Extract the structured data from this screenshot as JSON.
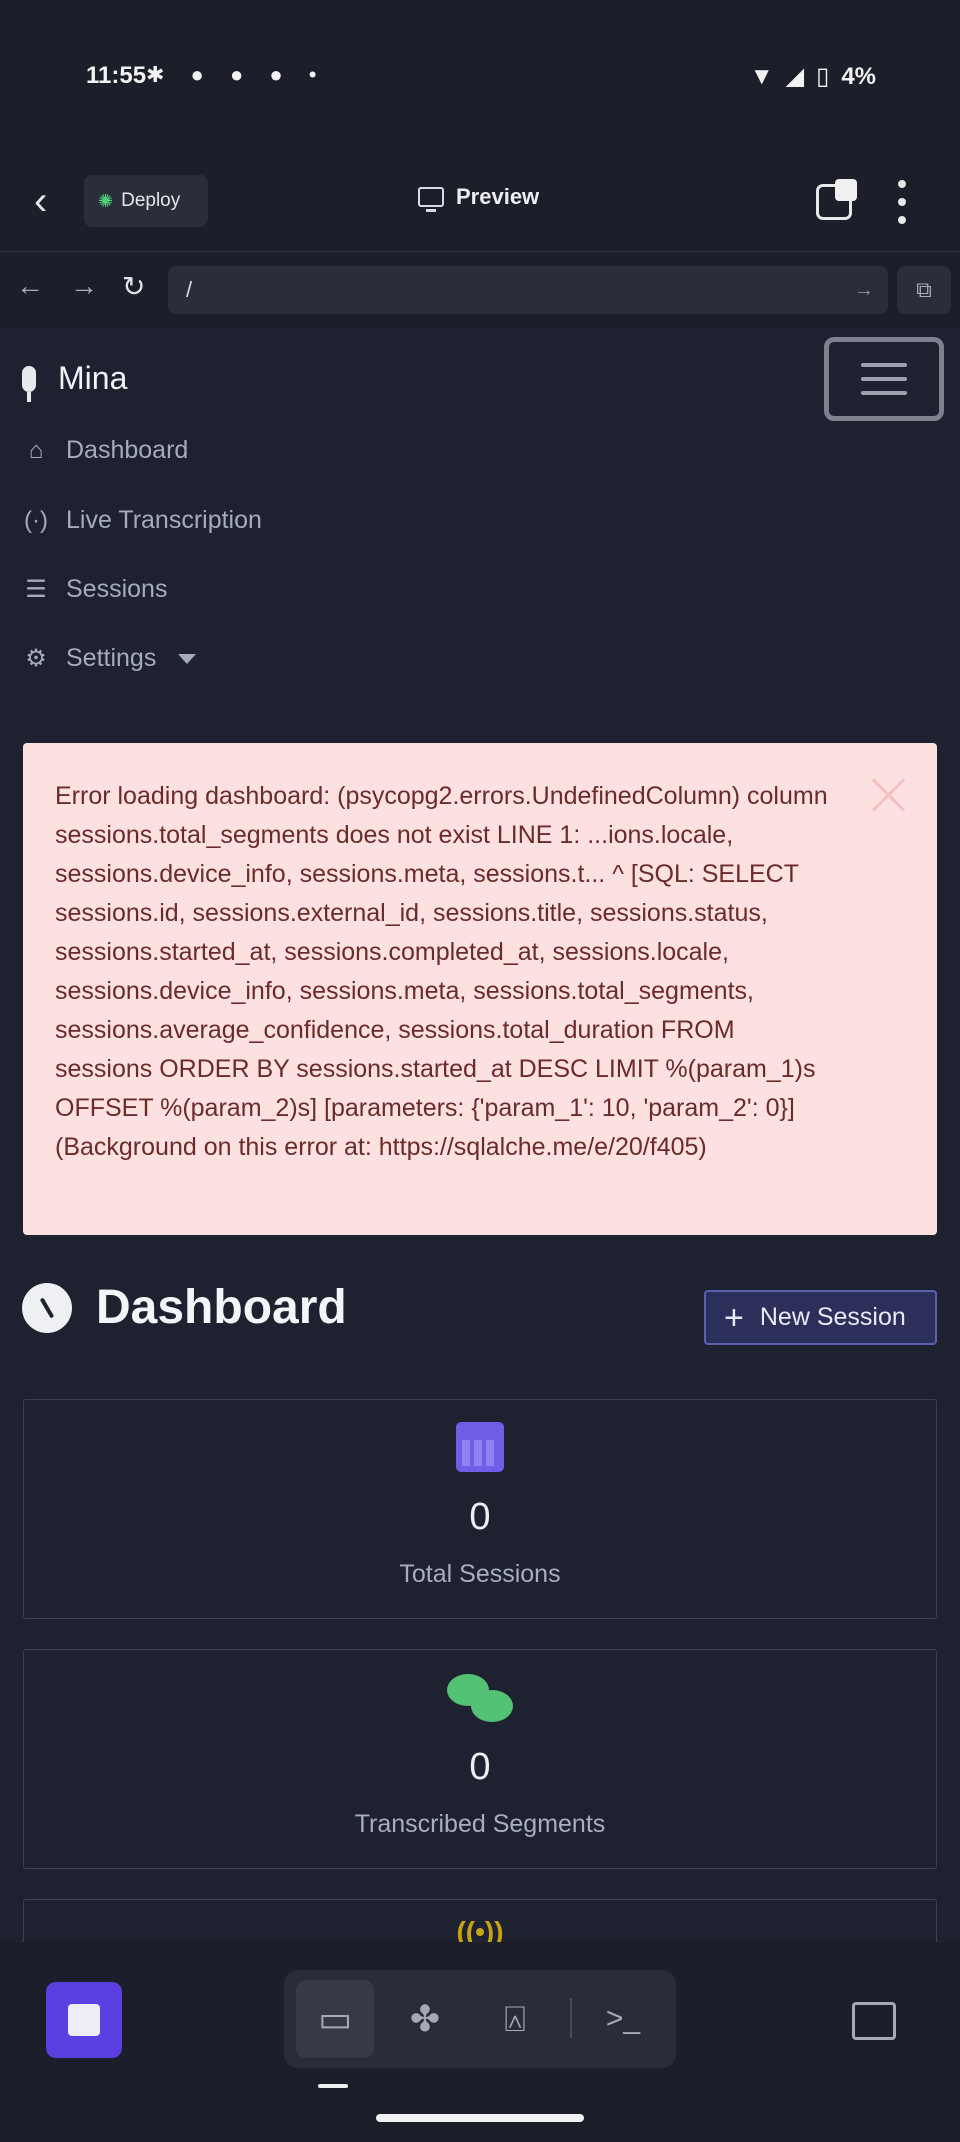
{
  "status_bar": {
    "time": "11:55",
    "notif_icons": "✱ ● ● ● •",
    "battery": "4%"
  },
  "header": {
    "back_icon": "chevron-left-icon",
    "deploy_label": "Deploy",
    "preview_label": "Preview"
  },
  "browser": {
    "url": "/",
    "back": "←",
    "forward": "→",
    "reload": "↻",
    "go": "→",
    "external": "⧉"
  },
  "app": {
    "brand": "Mina",
    "nav": [
      {
        "label": "Dashboard",
        "icon": "home-icon"
      },
      {
        "label": "Live Transcription",
        "icon": "broadcast-icon"
      },
      {
        "label": "Sessions",
        "icon": "list-icon"
      },
      {
        "label": "Settings",
        "icon": "gear-icon"
      }
    ],
    "alert_text": "Error loading dashboard: (psycopg2.errors.UndefinedColumn) column sessions.total_segments does not exist LINE 1: ...ions.locale, sessions.device_info, sessions.meta, sessions.t... ^ [SQL: SELECT sessions.id, sessions.external_id, sessions.title, sessions.status, sessions.started_at, sessions.completed_at, sessions.locale, sessions.device_info, sessions.meta, sessions.total_segments, sessions.average_confidence, sessions.total_duration FROM sessions ORDER BY sessions.started_at DESC LIMIT %(param_1)s OFFSET %(param_2)s] [parameters: {'param_1': 10, 'param_2': 0}] (Background on this error at: https://sqlalche.me/e/20/f405)",
    "page_title": "Dashboard",
    "new_session_label": "New Session",
    "cards": [
      {
        "value": "0",
        "label": "Total Sessions",
        "icon": "calendar-icon",
        "color": "#6f5ee8"
      },
      {
        "value": "0",
        "label": "Transcribed Segments",
        "icon": "comments-icon",
        "color": "#53c275"
      },
      {
        "icon": "broadcast-icon",
        "color": "#c7a312"
      }
    ]
  },
  "toolbar": {
    "stop_icon": "stop-icon",
    "tools": [
      "monitor-icon",
      "workspace-icon",
      "deploy-icon",
      "terminal-icon"
    ],
    "terminal_glyph": ">_",
    "sidebar_icon": "sidebar-toggle-icon"
  }
}
